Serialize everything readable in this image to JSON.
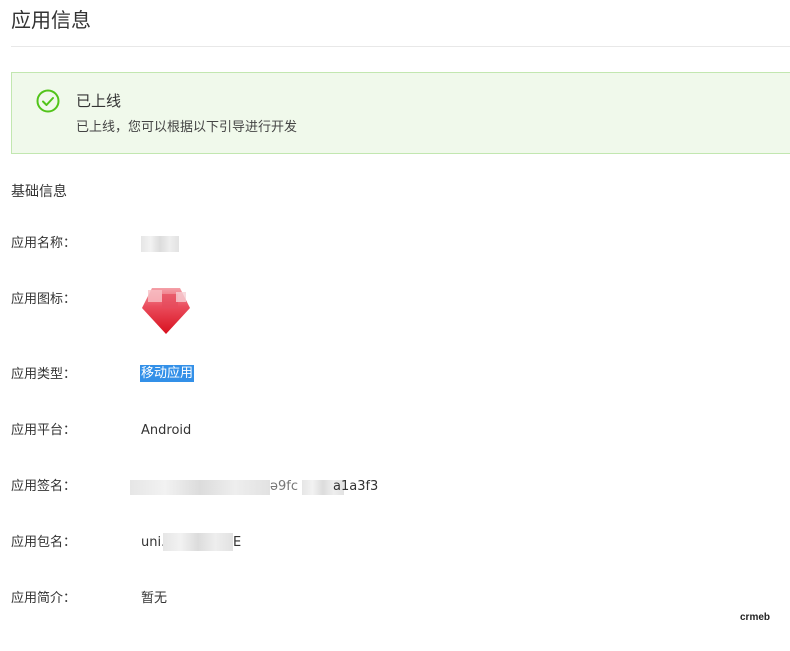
{
  "page": {
    "title": "应用信息"
  },
  "alert": {
    "title": "已上线",
    "description": "已上线，您可以根据以下引导进行开发",
    "icon": "check-circle-icon",
    "color": "#52c41a"
  },
  "section": {
    "title": "基础信息"
  },
  "fields": {
    "name": {
      "label": "应用名称：",
      "value": ""
    },
    "icon": {
      "label": "应用图标："
    },
    "type": {
      "label": "应用类型：",
      "value": "移动应用"
    },
    "platform": {
      "label": "应用平台：",
      "value": "Android"
    },
    "signature": {
      "label": "应用签名：",
      "value_visible_prefix": "",
      "value_visible_mid": "ə9fc",
      "value_visible_suffix": "a1a3f3"
    },
    "package": {
      "label": "应用包名：",
      "value_visible_prefix": "uni.",
      "value_visible_suffix": "E"
    },
    "intro": {
      "label": "应用简介：",
      "value": "暂无"
    }
  },
  "watermark": {
    "text": "crmeb"
  }
}
